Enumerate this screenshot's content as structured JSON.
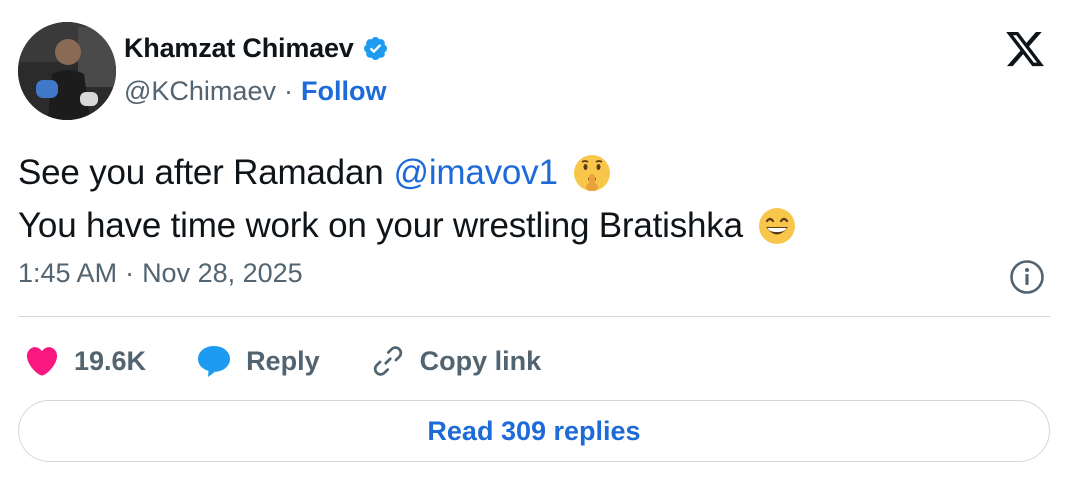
{
  "author": {
    "display_name": "Khamzat Chimaev",
    "handle": "@KChimaev",
    "separator": "·",
    "follow_label": "Follow",
    "verified": true
  },
  "tweet": {
    "line1_text": "See you after Ramadan",
    "mention": "@imavov1",
    "line1_emoji": "shushing-face-emoji",
    "line2_text": "You have time work on your wrestling Bratishka",
    "line2_emoji": "grinning-face-emoji"
  },
  "meta": {
    "time": "1:45 AM",
    "separator": "·",
    "date": "Nov 28, 2025"
  },
  "actions": {
    "like_count": "19.6K",
    "reply_label": "Reply",
    "copy_link_label": "Copy link"
  },
  "read_replies_label": "Read 309 replies",
  "colors": {
    "accent_blue": "#1d6ad8",
    "like_pink": "#f91880",
    "reply_blue": "#1d9bf0",
    "secondary_text": "#536471",
    "divider": "#cfd9de"
  },
  "icons": {
    "brand": "x-logo-icon",
    "verified": "verified-badge-icon",
    "info": "info-icon",
    "like": "heart-icon",
    "reply": "speech-bubble-icon",
    "copy_link": "link-icon"
  }
}
